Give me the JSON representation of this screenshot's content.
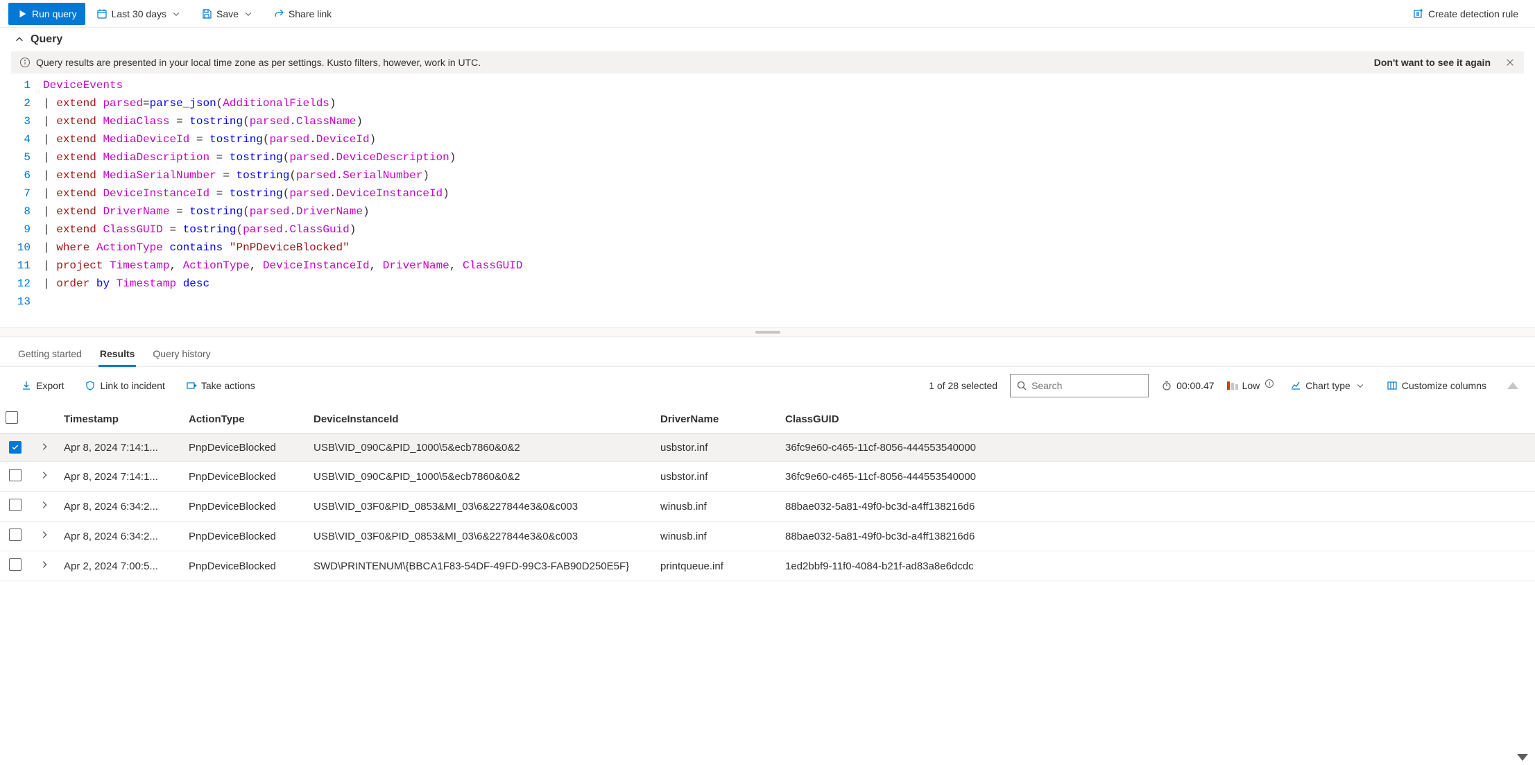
{
  "toolbar": {
    "run_label": "Run query",
    "timerange_label": "Last 30 days",
    "save_label": "Save",
    "share_label": "Share link",
    "create_rule_label": "Create detection rule"
  },
  "query_header": "Query",
  "info_bar": {
    "text": "Query results are presented in your local time zone as per settings. Kusto filters, however, work in UTC.",
    "dismiss": "Don't want to see it again"
  },
  "editor": {
    "line_numbers": [
      "1",
      "2",
      "3",
      "4",
      "5",
      "6",
      "7",
      "8",
      "9",
      "10",
      "11",
      "12",
      "13"
    ]
  },
  "tabs": {
    "getting_started": "Getting started",
    "results": "Results",
    "history": "Query history"
  },
  "results_toolbar": {
    "export": "Export",
    "link_incident": "Link to incident",
    "take_actions": "Take actions",
    "selected_text": "1 of 28 selected",
    "search_placeholder": "Search",
    "elapsed": "00:00.47",
    "severity": "Low",
    "chart_type": "Chart type",
    "customize": "Customize columns"
  },
  "table": {
    "headers": {
      "timestamp": "Timestamp",
      "action_type": "ActionType",
      "device_instance": "DeviceInstanceId",
      "driver_name": "DriverName",
      "class_guid": "ClassGUID"
    },
    "rows": [
      {
        "selected": true,
        "ts": "Apr 8, 2024 7:14:1...",
        "at": "PnpDeviceBlocked",
        "di": "USB\\VID_090C&PID_1000\\5&ecb7860&0&2",
        "dn": "usbstor.inf",
        "cg": "36fc9e60-c465-11cf-8056-444553540000"
      },
      {
        "selected": false,
        "ts": "Apr 8, 2024 7:14:1...",
        "at": "PnpDeviceBlocked",
        "di": "USB\\VID_090C&PID_1000\\5&ecb7860&0&2",
        "dn": "usbstor.inf",
        "cg": "36fc9e60-c465-11cf-8056-444553540000"
      },
      {
        "selected": false,
        "ts": "Apr 8, 2024 6:34:2...",
        "at": "PnpDeviceBlocked",
        "di": "USB\\VID_03F0&PID_0853&MI_03\\6&227844e3&0&c003",
        "dn": "winusb.inf",
        "cg": "88bae032-5a81-49f0-bc3d-a4ff138216d6"
      },
      {
        "selected": false,
        "ts": "Apr 8, 2024 6:34:2...",
        "at": "PnpDeviceBlocked",
        "di": "USB\\VID_03F0&PID_0853&MI_03\\6&227844e3&0&c003",
        "dn": "winusb.inf",
        "cg": "88bae032-5a81-49f0-bc3d-a4ff138216d6"
      },
      {
        "selected": false,
        "ts": "Apr 2, 2024 7:00:5...",
        "at": "PnpDeviceBlocked",
        "di": "SWD\\PRINTENUM\\{BBCA1F83-54DF-49FD-99C3-FAB90D250E5F}",
        "dn": "printqueue.inf",
        "cg": "1ed2bbf9-11f0-4084-b21f-ad83a8e6dcdc"
      }
    ]
  }
}
